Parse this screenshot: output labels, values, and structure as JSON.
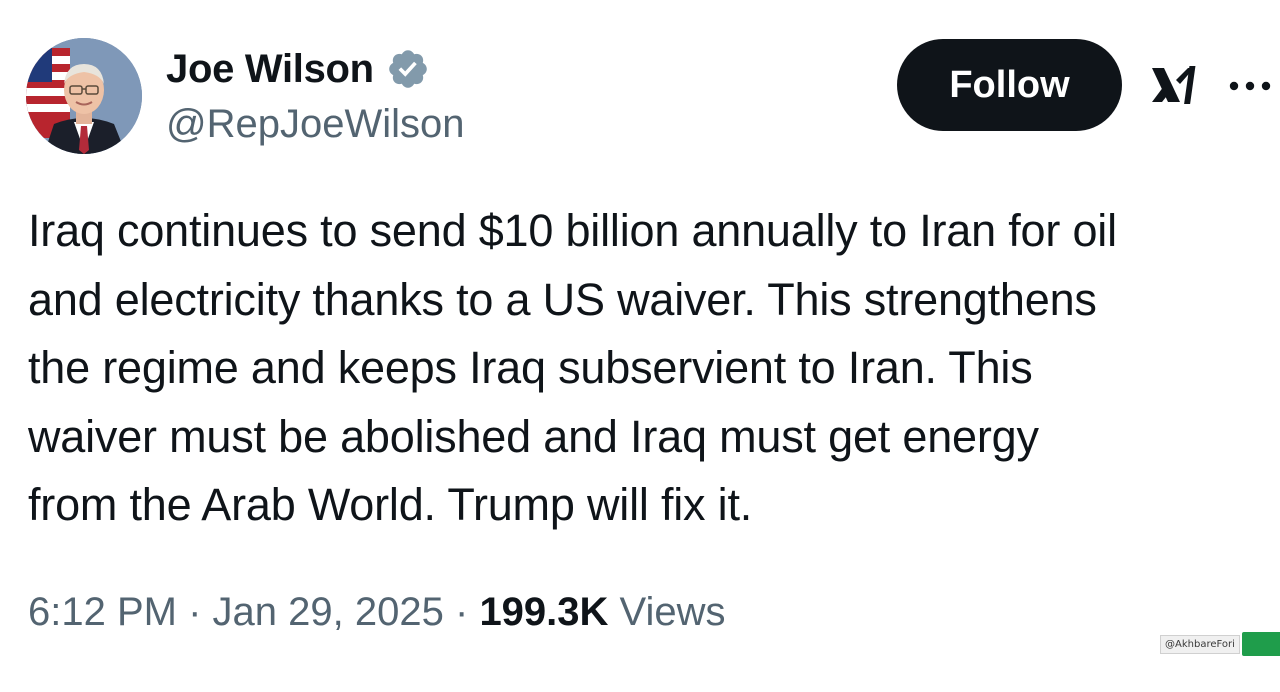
{
  "author": {
    "display_name": "Joe Wilson",
    "handle": "@RepJoeWilson",
    "verified_icon": "verified-badge-icon"
  },
  "actions": {
    "follow_label": "Follow",
    "grok_icon": "grok-icon",
    "more_icon": "more-options-icon"
  },
  "tweet": {
    "lines": [
      "Iraq continues to send $10 billion annually to Iran for oil",
      "and electricity thanks to a US waiver. This strengthens",
      "the regime and keeps Iraq subservient to Iran. This",
      "waiver must be abolished and Iraq must get energy",
      "from the Arab World. Trump will fix it."
    ]
  },
  "meta": {
    "time": "6:12 PM",
    "separator": "·",
    "date": "Jan 29, 2025",
    "views_count": "199.3K",
    "views_label": "Views"
  },
  "watermark": {
    "text": "@AkhbareFori"
  },
  "colors": {
    "text_primary": "#0f1419",
    "text_secondary": "#536471",
    "verified_gray": "#829aab",
    "button_bg": "#0f1419",
    "watermark_green": "#1f9d4b"
  }
}
